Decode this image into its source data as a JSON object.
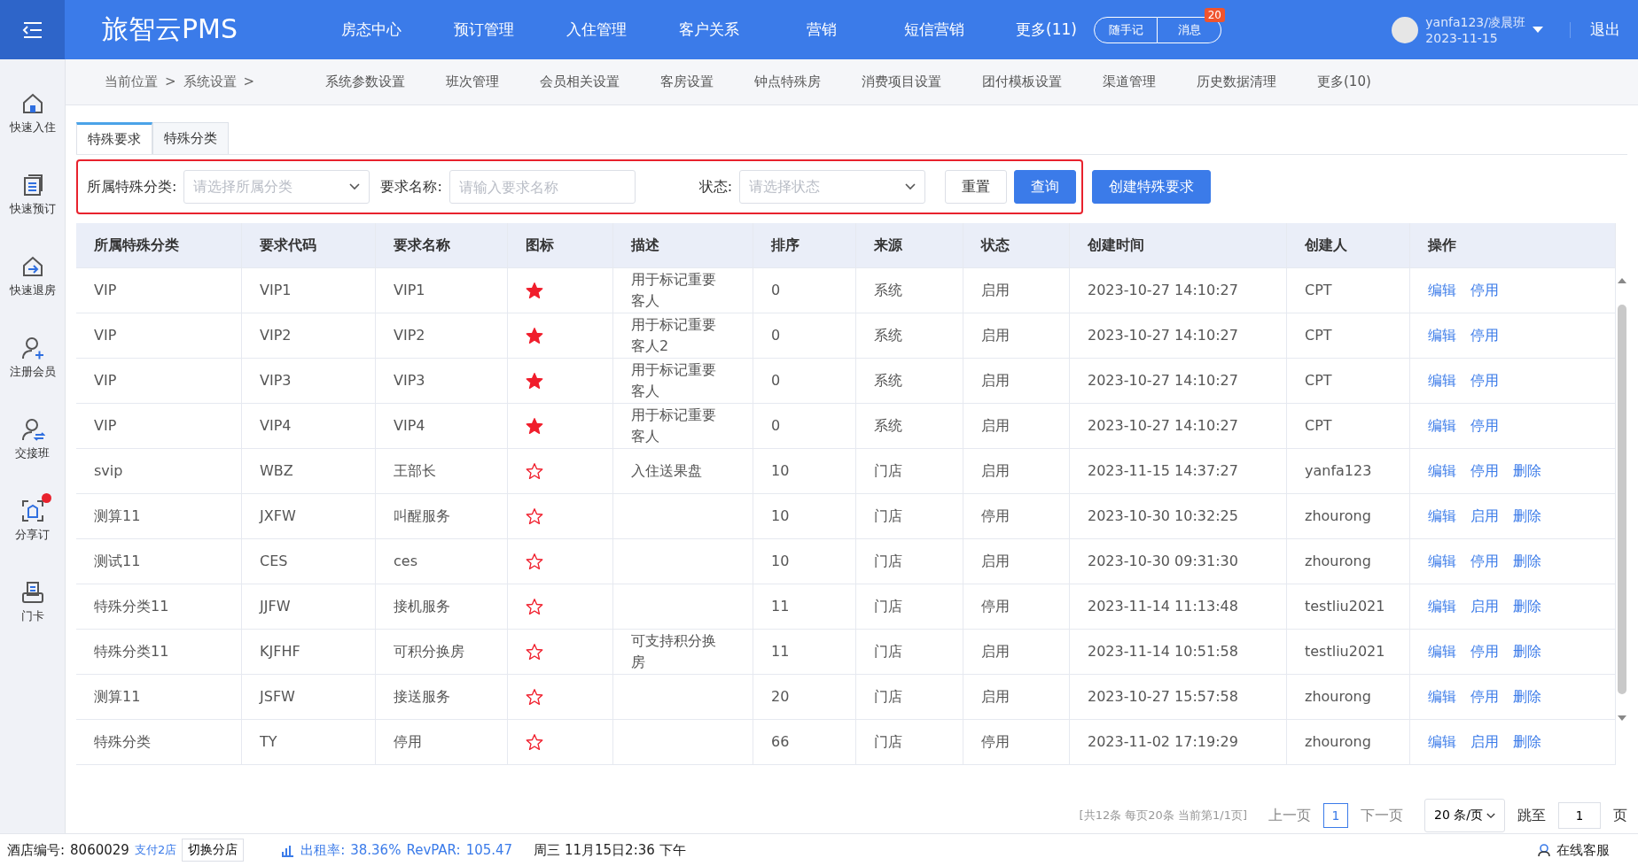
{
  "app": {
    "logo": "旅智云PMS"
  },
  "top_nav": [
    {
      "label": "房态中心",
      "selected": false
    },
    {
      "label": "预订管理",
      "selected": false
    },
    {
      "label": "入住管理",
      "selected": false
    },
    {
      "label": "客户关系",
      "selected": false
    },
    {
      "label": "营销",
      "selected": false
    },
    {
      "label": "短信营销",
      "selected": false
    },
    {
      "label": "更多(11)",
      "selected": false
    }
  ],
  "quick_buttons": [
    {
      "label": "随手记"
    },
    {
      "label": "消息",
      "badge": "20"
    }
  ],
  "user": {
    "name": "yanfa123/凌晨班",
    "date": "2023-11-15",
    "logout": "退出"
  },
  "sidebar": [
    {
      "kind": "checkin",
      "label": "快速入住"
    },
    {
      "kind": "booking",
      "label": "快速预订"
    },
    {
      "kind": "checkout",
      "label": "快速退房"
    },
    {
      "kind": "member",
      "label": "注册会员"
    },
    {
      "kind": "shift",
      "label": "交接班"
    },
    {
      "kind": "share",
      "label": "分享订",
      "dot": true
    },
    {
      "kind": "card",
      "label": "门卡"
    }
  ],
  "breadcrumb": [
    {
      "label": "当前位置",
      "separator": ">"
    },
    {
      "label": "系统设置",
      "separator": ">"
    }
  ],
  "sub_nav": [
    "系统参数设置",
    "班次管理",
    "会员相关设置",
    "客房设置",
    "钟点特殊房",
    "消费项目设置",
    "团付模板设置",
    "渠道管理",
    "历史数据清理",
    "更多(10)"
  ],
  "tabs": [
    {
      "label": "特殊要求",
      "selected": true
    },
    {
      "label": "特殊分类",
      "selected": false
    }
  ],
  "filters": [
    {
      "kind": "select",
      "label": "所属特殊分类:",
      "placeholder": "请选择所属分类"
    },
    {
      "kind": "input",
      "label": "要求名称:",
      "placeholder": "请输入要求名称"
    },
    {
      "kind": "select",
      "label": "状态:",
      "placeholder": "请选择状态"
    }
  ],
  "filter_buttons": [
    {
      "label": "重置",
      "primary": false
    },
    {
      "label": "查询",
      "primary": true
    }
  ],
  "create_button": "创建特殊要求",
  "table": {
    "columns": [
      "所属特殊分类",
      "要求代码",
      "要求名称",
      "图标",
      "描述",
      "排序",
      "来源",
      "状态",
      "创建时间",
      "创建人",
      "操作"
    ],
    "rows": [
      {
        "category": "VIP",
        "code": "VIP1",
        "name": "VIP1",
        "star_filled": true,
        "description": "用于标记重要客人",
        "order": "0",
        "source": "系统",
        "status": "启用",
        "created": "2023-10-27 14:10:27",
        "creator": "CPT",
        "actions": [
          "编辑",
          "停用"
        ]
      },
      {
        "category": "VIP",
        "code": "VIP2",
        "name": "VIP2",
        "star_filled": true,
        "description": "用于标记重要客人2",
        "order": "0",
        "source": "系统",
        "status": "启用",
        "created": "2023-10-27 14:10:27",
        "creator": "CPT",
        "actions": [
          "编辑",
          "停用"
        ]
      },
      {
        "category": "VIP",
        "code": "VIP3",
        "name": "VIP3",
        "star_filled": true,
        "description": "用于标记重要客人",
        "order": "0",
        "source": "系统",
        "status": "启用",
        "created": "2023-10-27 14:10:27",
        "creator": "CPT",
        "actions": [
          "编辑",
          "停用"
        ]
      },
      {
        "category": "VIP",
        "code": "VIP4",
        "name": "VIP4",
        "star_filled": true,
        "description": "用于标记重要客人",
        "order": "0",
        "source": "系统",
        "status": "启用",
        "created": "2023-10-27 14:10:27",
        "creator": "CPT",
        "actions": [
          "编辑",
          "停用"
        ]
      },
      {
        "category": "svip",
        "code": "WBZ",
        "name": "王部长",
        "star_filled": false,
        "description": "入住送果盘",
        "order": "10",
        "source": "门店",
        "status": "启用",
        "created": "2023-11-15 14:37:27",
        "creator": "yanfa123",
        "actions": [
          "编辑",
          "停用",
          "删除"
        ]
      },
      {
        "category": "测算11",
        "code": "JXFW",
        "name": "叫醒服务",
        "star_filled": false,
        "description": "",
        "order": "10",
        "source": "门店",
        "status": "停用",
        "created": "2023-10-30 10:32:25",
        "creator": "zhourong",
        "actions": [
          "编辑",
          "启用",
          "删除"
        ]
      },
      {
        "category": "测试11",
        "code": "CES",
        "name": "ces",
        "star_filled": false,
        "description": "",
        "order": "10",
        "source": "门店",
        "status": "启用",
        "created": "2023-10-30 09:31:30",
        "creator": "zhourong",
        "actions": [
          "编辑",
          "停用",
          "删除"
        ]
      },
      {
        "category": "特殊分类11",
        "code": "JJFW",
        "name": "接机服务",
        "star_filled": false,
        "description": "",
        "order": "11",
        "source": "门店",
        "status": "停用",
        "created": "2023-11-14 11:13:48",
        "creator": "testliu2021",
        "actions": [
          "编辑",
          "启用",
          "删除"
        ]
      },
      {
        "category": "特殊分类11",
        "code": "KJFHF",
        "name": "可积分换房",
        "star_filled": false,
        "description": "可支持积分换房",
        "order": "11",
        "source": "门店",
        "status": "启用",
        "created": "2023-11-14 10:51:58",
        "creator": "testliu2021",
        "actions": [
          "编辑",
          "停用",
          "删除"
        ]
      },
      {
        "category": "测算11",
        "code": "JSFW",
        "name": "接送服务",
        "star_filled": false,
        "description": "",
        "order": "20",
        "source": "门店",
        "status": "启用",
        "created": "2023-10-27 15:57:58",
        "creator": "zhourong",
        "actions": [
          "编辑",
          "停用",
          "删除"
        ]
      },
      {
        "category": "特殊分类",
        "code": "TY",
        "name": "停用",
        "star_filled": false,
        "description": "",
        "order": "66",
        "source": "门店",
        "status": "停用",
        "created": "2023-11-02 17:19:29",
        "creator": "zhourong",
        "actions": [
          "编辑",
          "启用",
          "删除"
        ]
      }
    ]
  },
  "pagination": {
    "summary": "[共12条 每页20条 当前第1/1页]",
    "prev": "上一页",
    "page": "1",
    "next": "下一页",
    "page_size": "20 条/页",
    "jump_label": "跳至",
    "jump_value": "1",
    "page_unit": "页"
  },
  "status_bar": {
    "hotel_label": "酒店编号:",
    "hotel_id": "8060029",
    "branches": "支付2店",
    "switch": "切换分店",
    "occupancy": "出租率:",
    "occupancy_value": "38.36%",
    "revpar": "RevPAR:",
    "revpar_value": "105.47",
    "datetime": "周三 11月15日2:36 下午",
    "support": "在线客服"
  }
}
